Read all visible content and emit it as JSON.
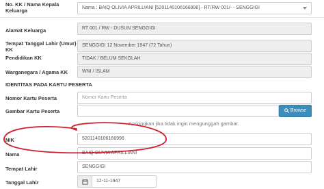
{
  "form": {
    "kk": {
      "label": "No. KK / Nama Kepala Keluarga",
      "value": "Nama : BAIQ OLIVIA APRILLIANI [5201140106166996] - RT/RW 001/- - SENGGIGI"
    },
    "alamat": {
      "label": "Alamat Keluarga",
      "value": "RT 001 / RW - DUSUN SENGGIGI"
    },
    "ttl_umur": {
      "label": "Tempat Tanggal Lahir (Umur) KK",
      "value": "SENGGIGI 12 November 1947 (72 Tahun)"
    },
    "pendidikan": {
      "label": "Pendidikan KK",
      "value": "TIDAK / BELUM SEKOLAH"
    },
    "warganegara": {
      "label": "Warganegara / Agama KK",
      "value": "WNI / ISLAM"
    },
    "section_title": "IDENTITAS PADA KARTU PESERTA",
    "nomor_kartu": {
      "label": "Nomor Kartu Peserta",
      "placeholder": "Nomor Kartu Peserta"
    },
    "gambar_kartu": {
      "label": "Gambar Kartu Peserta",
      "browse_label": "Browse",
      "help": "Kosongkan jika tidak ingin mengunggah gambar."
    },
    "nik": {
      "label": "NIK",
      "value": "5201140106166996"
    },
    "nama": {
      "label": "Nama",
      "value": "BAIQ OLIVIA APRILLIANI"
    },
    "tempat_lahir": {
      "label": "Tempat Lahir",
      "value": "SENGGIGI"
    },
    "tanggal_lahir": {
      "label": "Tanggal Lahir",
      "value": "12-11-1947"
    }
  },
  "colors": {
    "browse_button": "#3c8dbc",
    "annotation": "#d0202e",
    "readonly_bg": "#eeeeee"
  },
  "icons": {
    "select": "chevron-down-icon",
    "browse": "search-icon",
    "date": "calendar-icon"
  }
}
